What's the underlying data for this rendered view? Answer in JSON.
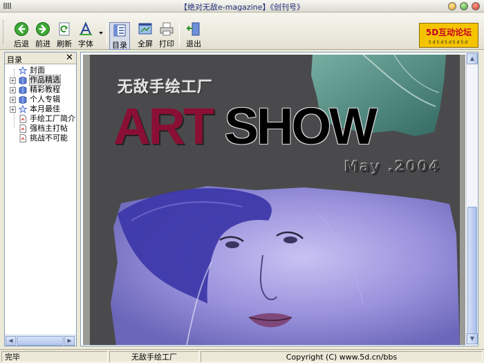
{
  "window": {
    "title": "【绝对无敌e-magazine】《创刊号》"
  },
  "toolbar": {
    "back_label": "后退",
    "forward_label": "前进",
    "refresh_label": "刷新",
    "font_label": "字体",
    "toc_label": "目录",
    "fullscreen_label": "全屏",
    "print_label": "打印",
    "exit_label": "退出",
    "logo_text": "5D互动论坛",
    "logo_sub": "5d5d5d5d5d"
  },
  "sidebar": {
    "title": "目录",
    "close_glyph": "✕",
    "items": [
      {
        "label": "封面",
        "icon": "star-icon",
        "expandable": false,
        "selected": false
      },
      {
        "label": "作品精选",
        "icon": "book-icon",
        "expandable": true,
        "selected": true
      },
      {
        "label": "精彩教程",
        "icon": "book-icon",
        "expandable": true,
        "selected": false
      },
      {
        "label": "个人专辑",
        "icon": "book-icon",
        "expandable": true,
        "selected": false
      },
      {
        "label": "本月最佳",
        "icon": "star-icon",
        "expandable": true,
        "selected": false
      },
      {
        "label": "手绘工厂简介",
        "icon": "page-icon",
        "expandable": false,
        "selected": false
      },
      {
        "label": "强档主打帖",
        "icon": "page-icon",
        "expandable": false,
        "selected": false
      },
      {
        "label": "挑战不可能",
        "icon": "page-icon",
        "expandable": false,
        "selected": false
      }
    ]
  },
  "cover": {
    "subtitle": "无敌手绘工厂",
    "title_art": "ART",
    "title_show": "SHOW",
    "date": "May .2004"
  },
  "status": {
    "left": "完毕",
    "middle": "无敌手绘工厂",
    "right": "Copyright (C) www.5d.cn/bbs"
  },
  "colors": {
    "art_red": "#8a0f34",
    "cover_bg": "#4a4a4c",
    "teal_splash": "#4d8c82",
    "face_violet": "#9a92dc"
  }
}
